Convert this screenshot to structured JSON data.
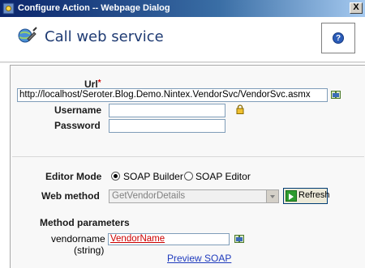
{
  "window": {
    "title": "Configure Action -- Webpage Dialog",
    "close_label": "X"
  },
  "header": {
    "heading": "Call web service",
    "help_label": "?"
  },
  "form": {
    "url_label": "Url",
    "url_required_mark": "*",
    "url_value": "http://localhost/Seroter.Blog.Demo.Nintex.VendorSvc/VendorSvc.asmx",
    "username_label": "Username",
    "username_value": "",
    "password_label": "Password",
    "password_value": "",
    "editor_mode_label": "Editor Mode",
    "editor_modes": [
      {
        "label": "SOAP Builder",
        "selected": true
      },
      {
        "label": "SOAP Editor",
        "selected": false
      }
    ],
    "web_method_label": "Web method",
    "web_method_value": "GetVendorDetails",
    "refresh_label": "Refresh",
    "method_parameters_label": "Method parameters",
    "parameters": [
      {
        "name": "vendorname",
        "type": "(string)",
        "value": "VendorName"
      }
    ],
    "preview_link": "Preview SOAP"
  },
  "icons": {
    "app": "gear-icon",
    "header": "globe-web-service-icon",
    "help": "help-icon",
    "url_lookup": "insert-reference-icon",
    "password_lock": "lock-icon",
    "refresh": "refresh-arrow-icon",
    "param_lookup": "insert-reference-icon"
  },
  "colors": {
    "titlebar_start": "#0a246a",
    "heading": "#1f3b73",
    "link": "#1f3bbd",
    "required": "#d00000",
    "param_value": "#cc0000"
  }
}
